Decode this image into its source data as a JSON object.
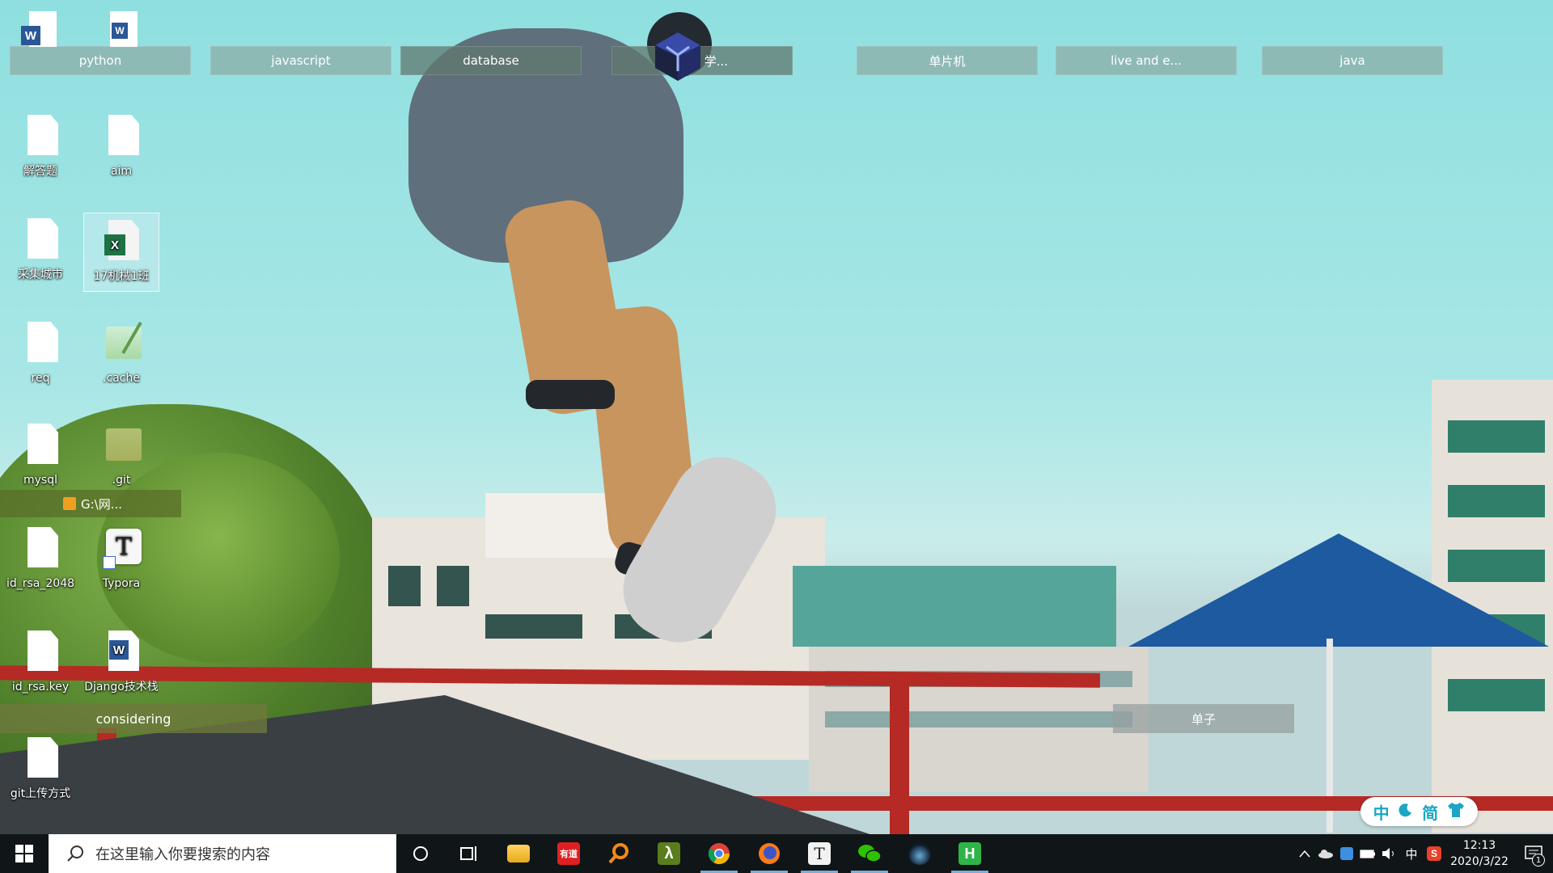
{
  "fences": [
    {
      "id": "python",
      "label": "python"
    },
    {
      "id": "javascript",
      "label": "javascript"
    },
    {
      "id": "database",
      "label": "database"
    },
    {
      "id": "study",
      "label": "学..."
    },
    {
      "id": "mcu",
      "label": "单片机"
    },
    {
      "id": "live",
      "label": "live and e..."
    },
    {
      "id": "java",
      "label": "java"
    },
    {
      "id": "considering",
      "label": "considering"
    },
    {
      "id": "danzi",
      "label": "单子"
    },
    {
      "id": "shortcut",
      "label": "G:\\网..."
    }
  ],
  "icons": [
    {
      "label": "解答题"
    },
    {
      "label": "aim"
    },
    {
      "label": "采集城市"
    },
    {
      "label": "17机械1班"
    },
    {
      "label": "req"
    },
    {
      "label": ".cache"
    },
    {
      "label": "mysql"
    },
    {
      "label": ".git"
    },
    {
      "label": "id_rsa_2048"
    },
    {
      "label": "Typora"
    },
    {
      "label": "id_rsa.key"
    },
    {
      "label": "Django技术栈"
    },
    {
      "label": "git上传方式"
    }
  ],
  "ime_widget": {
    "chars": [
      "中",
      "简"
    ],
    "icons": [
      "moon-icon",
      "shirt-icon"
    ]
  },
  "taskbar": {
    "search_placeholder": "在这里输入你要搜索的内容",
    "apps": [
      {
        "name": "file-explorer"
      },
      {
        "name": "youdao",
        "badge": "有道"
      },
      {
        "name": "search-tool"
      },
      {
        "name": "lambda-app",
        "badge": "λ"
      },
      {
        "name": "chrome"
      },
      {
        "name": "firefox"
      },
      {
        "name": "typora",
        "badge": "T"
      },
      {
        "name": "wechat"
      },
      {
        "name": "dark-app"
      },
      {
        "name": "hbuilder",
        "badge": "H"
      }
    ],
    "tray": {
      "ime": "中",
      "time": "12:13",
      "date": "2020/3/22",
      "notification_count": "1"
    }
  },
  "colors": {
    "taskbar": "#101518",
    "fence": "#8caaa5",
    "accent": "#7aaed6"
  }
}
